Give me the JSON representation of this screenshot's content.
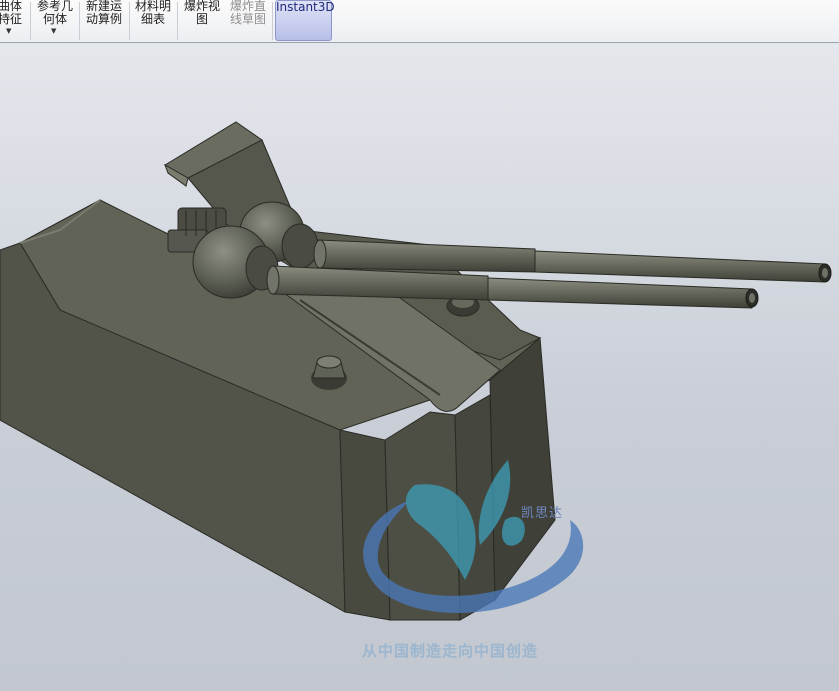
{
  "toolbar": {
    "buttons": [
      {
        "line1": "曲体",
        "line2": "持征",
        "has_dropdown": true
      },
      {
        "line1": "参考几",
        "line2": "何体",
        "has_dropdown": true
      },
      {
        "line1": "新建运",
        "line2": "动算例"
      },
      {
        "line1": "材料明",
        "line2": "细表"
      },
      {
        "line1": "爆炸视",
        "line2": "图"
      },
      {
        "line1": "爆炸直",
        "line2": "线草图"
      },
      {
        "line1": "Instant3D",
        "line2": ""
      }
    ]
  },
  "watermark": {
    "brand_name": "凯思达",
    "slogan": "从中国制造走向中国创造"
  },
  "colors": {
    "model_body": "#5c5e52",
    "model_dark": "#3f4138",
    "watermark_blue": "#4a78b8",
    "watermark_teal": "#3d9bb5"
  }
}
